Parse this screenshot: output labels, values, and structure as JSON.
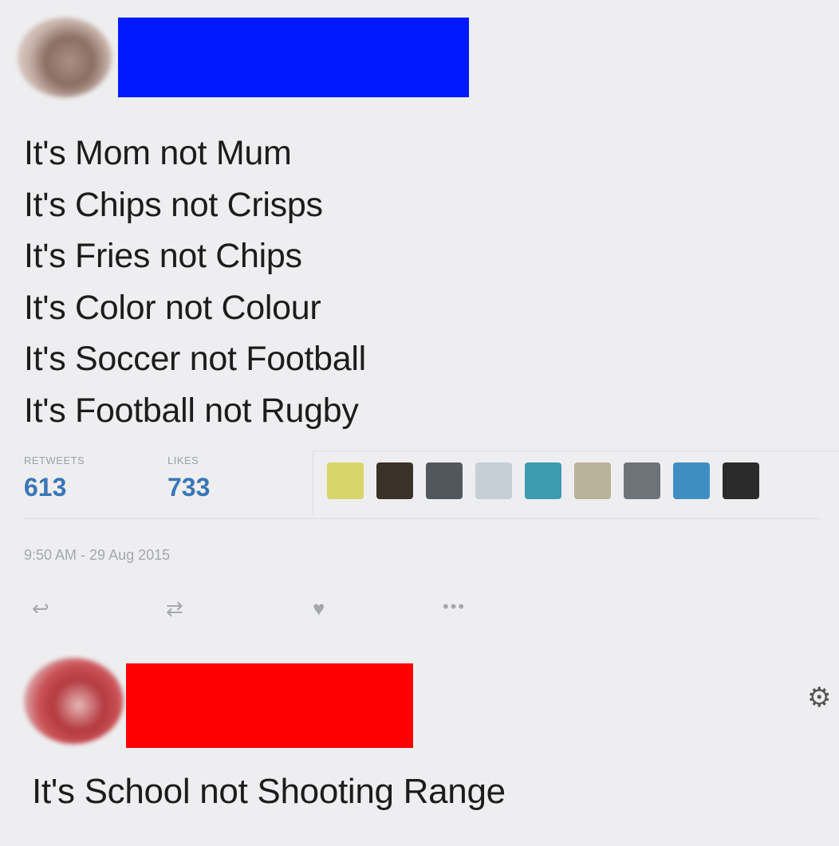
{
  "tweet": {
    "author_name_color": "#0019ff",
    "lines": [
      "It's Mom not Mum",
      "It's Chips not Crisps",
      "It's Fries not Chips",
      "It's Color not Colour",
      "It's Soccer not Football",
      "It's Football not Rugby"
    ],
    "stats": {
      "retweets_label": "RETWEETS",
      "retweets_value": "613",
      "likes_label": "LIKES",
      "likes_value": "733"
    },
    "liker_colors": [
      "#d8d56a",
      "#3a3128",
      "#52575d",
      "#c6cfd6",
      "#3e9bb0",
      "#b9b29a",
      "#6e7379",
      "#3f8ec2",
      "#2b2b2b"
    ],
    "timestamp": "9:50 AM - 29 Aug 2015",
    "actions": {
      "reply_icon": "reply-icon",
      "retweet_icon": "retweet-icon",
      "like_icon": "heart-icon",
      "more_icon": "more-icon"
    }
  },
  "reply": {
    "author_name_color": "#ff0000",
    "text": "It's School not Shooting Range",
    "settings_icon": "gear-icon"
  }
}
